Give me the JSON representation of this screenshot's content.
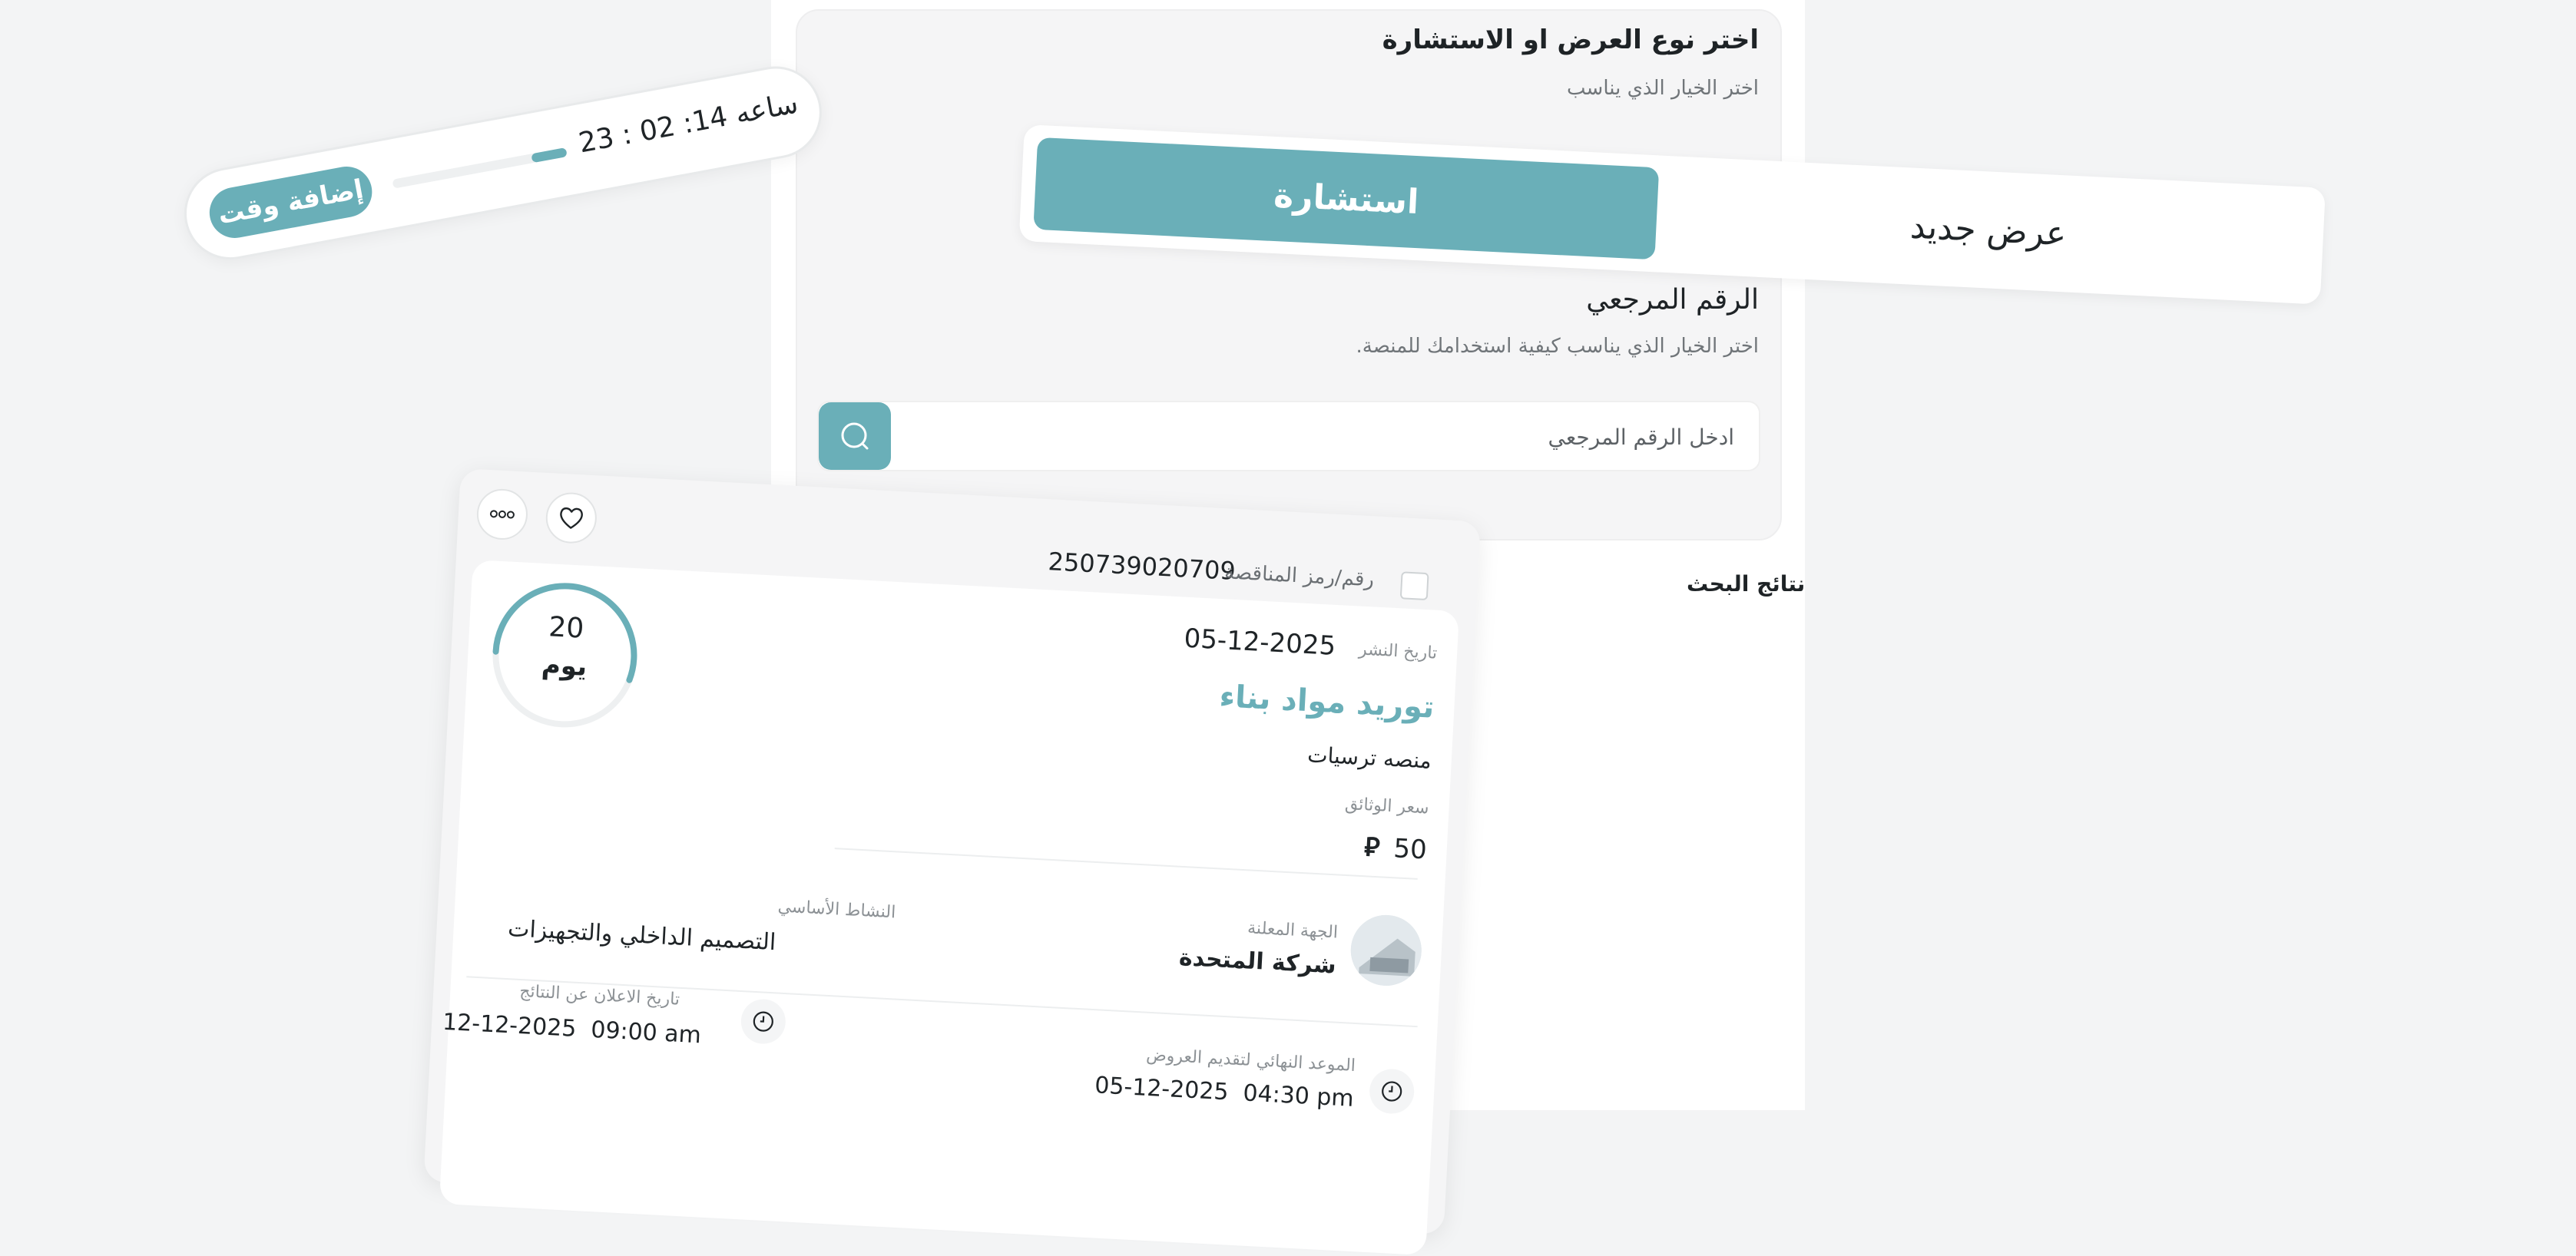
{
  "colors": {
    "accent": "#6aafb8",
    "background": "#f3f4f5",
    "card": "#f5f5f6",
    "text": "#1f2427",
    "muted": "#8c9195"
  },
  "offer_type": {
    "title": "اختر نوع العرض او الاستشارة",
    "subtitle": "اختر الخيار الذي يناسب",
    "toggle": {
      "active_label": "استشارة",
      "inactive_label": "عرض جديد",
      "selected": "استشارة"
    }
  },
  "reference": {
    "title": "الرقم المرجعي",
    "subtitle": "اختر الخيار الذي يناسب كيفية استخدامك للمنصة.",
    "search_placeholder": "ادخل الرقم المرجعي",
    "search_icon": "search-icon"
  },
  "results": {
    "label": "نتائج البحث"
  },
  "timer": {
    "time_text": "23 : 02 :14 ساعه",
    "button_label": "إضافة وقت",
    "progress": 0.2
  },
  "tender": {
    "code_label": "رقم/رمز المناقصة",
    "code_value": "250739020709",
    "publish_label": "تاريخ النشر",
    "publish_date": "05-12-2025",
    "title": "توريد مواد بناء",
    "platform": "منصه ترسيات",
    "doc_price_label": "سعر الوثائق",
    "doc_price_value": "50",
    "currency_icon": "riyal-icon",
    "days_count": "20",
    "days_unit": "يوم",
    "days_progress": 0.55,
    "main_activity_label": "النشاط الأساسي",
    "main_activity_value": "التصميم الداخلي والتجهيزات",
    "entity_label": "الجهة المعلنة",
    "entity_value": "شركة المتحدة",
    "deadline_label": "الموعد النهائي لتقديم العروض",
    "deadline_date": "05-12-2025",
    "deadline_time": "04:30 pm",
    "results_date_label": "تاريخ الاعلان عن النتائج",
    "results_date": "12-12-2025",
    "results_time": "09:00 am",
    "icons": {
      "favorite": "heart-icon",
      "more": "more-icon",
      "clock": "clock-icon"
    }
  }
}
